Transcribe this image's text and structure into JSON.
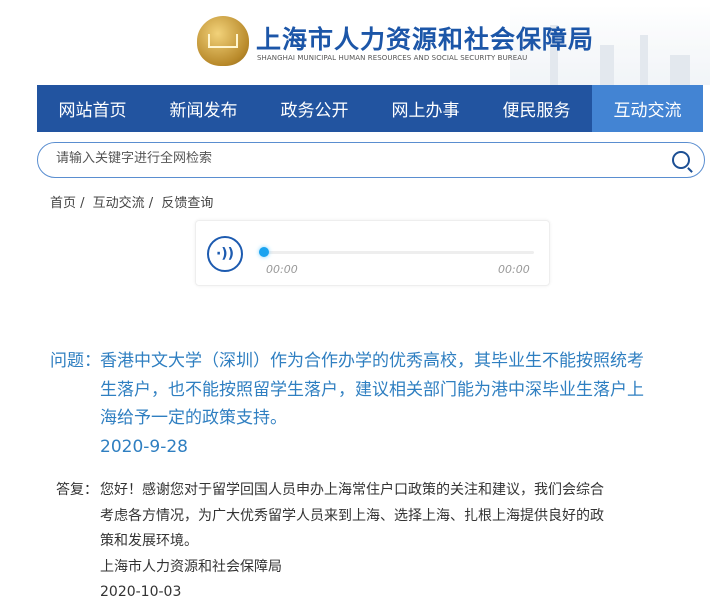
{
  "header": {
    "title_cn": "上海市人力资源和社会保障局",
    "title_en": "SHANGHAI MUNICIPAL HUMAN RESOURCES AND SOCIAL SECURITY BUREAU"
  },
  "nav": [
    {
      "label": "网站首页"
    },
    {
      "label": "新闻发布"
    },
    {
      "label": "政务公开"
    },
    {
      "label": "网上办事"
    },
    {
      "label": "便民服务"
    },
    {
      "label": "互动交流",
      "active": true
    }
  ],
  "search": {
    "placeholder": "请输入关键字进行全网检索",
    "value": ""
  },
  "breadcrumb": [
    "首页 /",
    "互动交流 /",
    "反馈查询"
  ],
  "audio": {
    "current": "00:00",
    "duration": "00:00",
    "progress": 0
  },
  "question": {
    "label": "问题：",
    "lines": [
      "香港中文大学（深圳）作为合作办学的优秀高校，其毕业生不能按照统考",
      "生落户，也不能按照留学生落户，建议相关部门能为港中深毕业生落户上",
      "海给予一定的政策支持。"
    ],
    "date": "2020-9-28"
  },
  "answer": {
    "label": "答复：",
    "lines": [
      "您好！感谢您对于留学回国人员申办上海常住户口政策的关注和建议，我们会综合",
      "考虑各方情况，为广大优秀留学人员来到上海、选择上海、扎根上海提供良好的政",
      "策和发展环境。"
    ],
    "org": "上海市人力资源和社会保障局",
    "date": "2020-10-03"
  }
}
